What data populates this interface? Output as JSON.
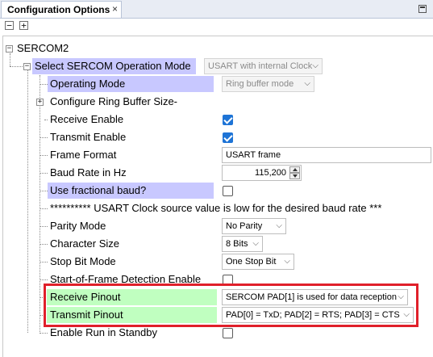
{
  "tab": {
    "title": "Configuration Options",
    "close": "×"
  },
  "toolbar": {
    "collapse": "−",
    "expand": "+"
  },
  "tree": {
    "root": "SERCOM2",
    "select_mode_label": "Select SERCOM Operation Mode",
    "select_mode_value": "USART with internal Clock",
    "operating_mode_label": "Operating Mode",
    "operating_mode_value": "Ring buffer mode",
    "ring_buffer_label": "Configure Ring Buffer Size-",
    "receive_enable_label": "Receive Enable",
    "transmit_enable_label": "Transmit Enable",
    "frame_format_label": "Frame Format",
    "frame_format_value": "USART frame",
    "baud_rate_label": "Baud Rate in Hz",
    "baud_rate_value": "115,200",
    "fractional_baud_label": "Use fractional baud?",
    "warning_text": "********** USART Clock source value is low for the desired baud rate ***",
    "parity_label": "Parity Mode",
    "parity_value": "No Parity",
    "char_size_label": "Character Size",
    "char_size_value": "8 Bits",
    "stop_bit_label": "Stop Bit Mode",
    "stop_bit_value": "One Stop Bit",
    "sof_label": "Start-of-Frame Detection Enable",
    "receive_pinout_label": "Receive Pinout",
    "receive_pinout_value": "SERCOM PAD[1] is used for data reception",
    "transmit_pinout_label": "Transmit Pinout",
    "transmit_pinout_value": "PAD[0] = TxD; PAD[2] = RTS; PAD[3] = CTS",
    "run_standby_label": "Enable Run in Standby"
  },
  "state": {
    "receive_enable": true,
    "transmit_enable": true,
    "fractional_baud": false,
    "sof_detection": false,
    "run_in_standby": false
  },
  "colors": {
    "highlight_blue": "#c8c8ff",
    "highlight_green": "#c0ffc0",
    "annotation_red": "#e0202a",
    "check_blue": "#1e74d6"
  },
  "icons": {
    "close": "close-icon",
    "minimize": "minimize-icon",
    "collapse_all": "collapse-all-icon",
    "expand_all": "expand-all-icon",
    "chevron": "chevron-down-icon"
  }
}
